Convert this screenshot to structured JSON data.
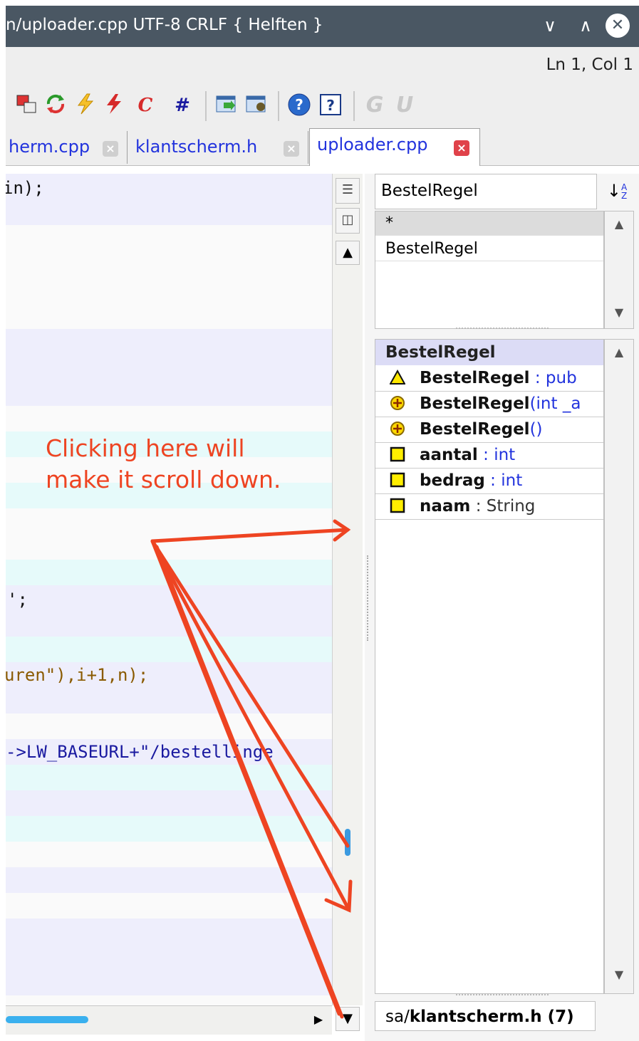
{
  "window": {
    "title": "n/uploader.cpp UTF-8 CRLF { Helften }",
    "minimize_glyph": "∨",
    "maximize_glyph": "∧",
    "close_glyph": "✕"
  },
  "status": {
    "cursor_position": "Ln 1, Col 1"
  },
  "toolbar": {
    "icons": [
      "windows-icon",
      "refresh-icon",
      "lightning-yellow-icon",
      "lightning-red-icon",
      "c-icon",
      "hash-icon",
      "export-icon",
      "settings-window-icon",
      "help-icon",
      "about-icon",
      "g-icon",
      "u-icon"
    ],
    "c_label": "C",
    "hash_label": "#",
    "help_label": "?",
    "about_label": "?",
    "g_label": "G",
    "u_label": "U"
  },
  "tabs": [
    {
      "label": "herm.cpp",
      "active": false
    },
    {
      "label": "klantscherm.h",
      "active": false
    },
    {
      "label": "uploader.cpp",
      "active": true
    }
  ],
  "editor": {
    "lines": [
      {
        "text": "in);"
      },
      {
        "text": "';"
      },
      {
        "text": "uren\"),i+1,n);"
      },
      {
        "text": "->LW_BASEURL+\"/bestellinge"
      }
    ]
  },
  "annotation": {
    "line1": "Clicking here will",
    "line2": "make it scroll down."
  },
  "outline": {
    "class_selector": "BestelRegel",
    "sort_glyph": "↓",
    "sort_az_top": "A",
    "sort_az_bottom": "Z",
    "class_list": [
      "*",
      "BestelRegel"
    ],
    "members_header": "BestelRegel",
    "members": [
      {
        "icon": "warning-icon",
        "name": "BestelRegel",
        "type": " : pub"
      },
      {
        "icon": "constructor-icon",
        "name": "BestelRegel",
        "type": "(int _a"
      },
      {
        "icon": "constructor-icon",
        "name": "BestelRegel",
        "type": "()"
      },
      {
        "icon": "field-icon",
        "name": "aantal",
        "type": " : int"
      },
      {
        "icon": "field-icon",
        "name": "bedrag",
        "type": " : int"
      },
      {
        "icon": "field-icon",
        "name": "naam",
        "type": " : String"
      }
    ],
    "file_prefix": "sa/",
    "file_name": "klantscherm.h",
    "file_count": " (7)"
  },
  "colors": {
    "titlebar": "#4a5763",
    "annotation": "#ee4422",
    "tab_link": "#2233dd",
    "members_header": "#dcdcf6",
    "field_icon": "#ffee00",
    "close_active": "#e0424a"
  }
}
